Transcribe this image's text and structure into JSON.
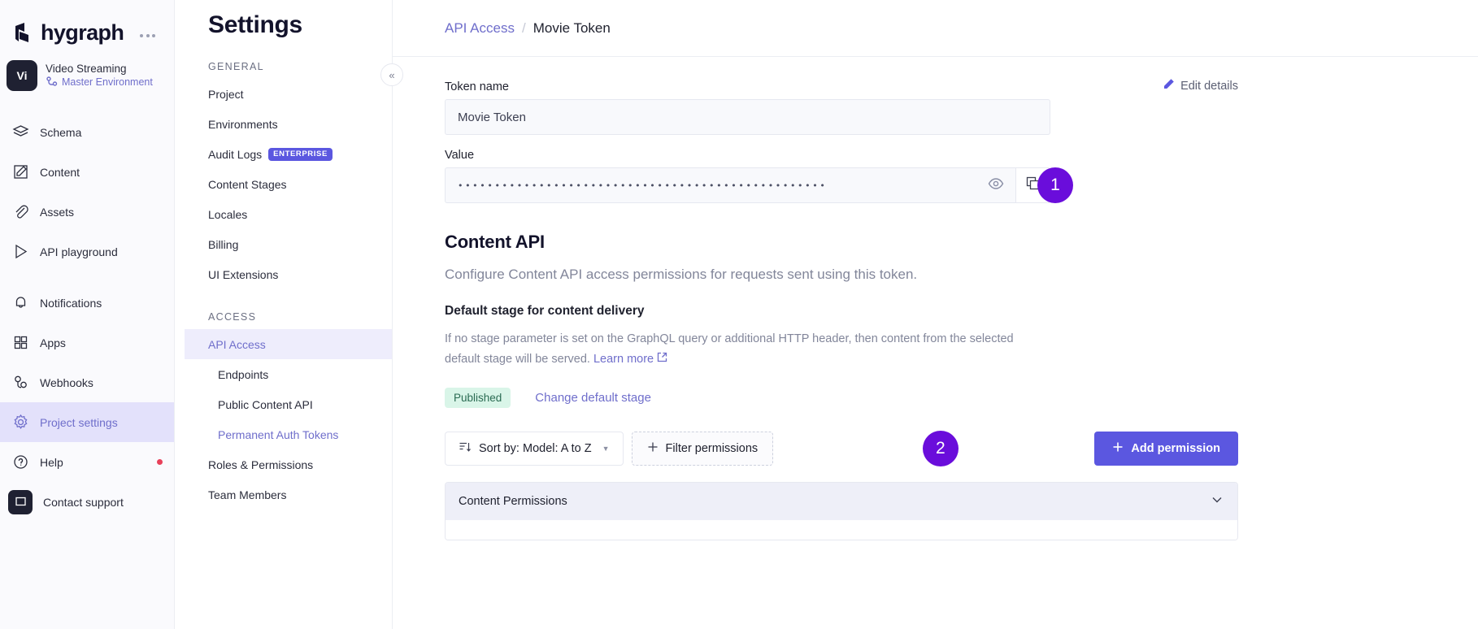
{
  "brand": {
    "name": "hygraph",
    "accent": "#5b57e0",
    "marker_color": "#6a0ddb"
  },
  "rail": {
    "project": {
      "avatar": "Vi",
      "name": "Video Streaming",
      "environment": "Master Environment"
    },
    "items": [
      {
        "label": "Schema",
        "icon": "layers-icon",
        "active": false
      },
      {
        "label": "Content",
        "icon": "edit-square-icon",
        "active": false
      },
      {
        "label": "Assets",
        "icon": "paperclip-icon",
        "active": false
      },
      {
        "label": "API playground",
        "icon": "play-icon",
        "active": false
      },
      {
        "label": "Notifications",
        "icon": "bell-icon",
        "active": false
      },
      {
        "label": "Apps",
        "icon": "grid-icon",
        "active": false
      },
      {
        "label": "Webhooks",
        "icon": "webhook-icon",
        "active": false
      },
      {
        "label": "Project settings",
        "icon": "gear-icon",
        "active": true
      },
      {
        "label": "Help",
        "icon": "question-circle-icon",
        "active": false
      },
      {
        "label": "Contact support",
        "icon": "chat-icon",
        "active": false
      }
    ]
  },
  "settings": {
    "title": "Settings",
    "groups": [
      {
        "label": "GENERAL",
        "items": [
          {
            "label": "Project",
            "badge": "",
            "active": false,
            "sub": false,
            "link": false
          },
          {
            "label": "Environments",
            "badge": "",
            "active": false,
            "sub": false,
            "link": false
          },
          {
            "label": "Audit Logs",
            "badge": "ENTERPRISE",
            "active": false,
            "sub": false,
            "link": false
          },
          {
            "label": "Content Stages",
            "badge": "",
            "active": false,
            "sub": false,
            "link": false
          },
          {
            "label": "Locales",
            "badge": "",
            "active": false,
            "sub": false,
            "link": false
          },
          {
            "label": "Billing",
            "badge": "",
            "active": false,
            "sub": false,
            "link": false
          },
          {
            "label": "UI Extensions",
            "badge": "",
            "active": false,
            "sub": false,
            "link": false
          }
        ]
      },
      {
        "label": "ACCESS",
        "items": [
          {
            "label": "API Access",
            "badge": "",
            "active": true,
            "sub": false,
            "link": false
          },
          {
            "label": "Endpoints",
            "badge": "",
            "active": false,
            "sub": true,
            "link": false
          },
          {
            "label": "Public Content API",
            "badge": "",
            "active": false,
            "sub": true,
            "link": false
          },
          {
            "label": "Permanent Auth Tokens",
            "badge": "",
            "active": false,
            "sub": true,
            "link": true
          },
          {
            "label": "Roles & Permissions",
            "badge": "",
            "active": false,
            "sub": false,
            "link": false
          },
          {
            "label": "Team Members",
            "badge": "",
            "active": false,
            "sub": false,
            "link": false
          }
        ]
      }
    ],
    "collapse_glyph": "«"
  },
  "breadcrumb": {
    "parent": "API Access",
    "separator": "/",
    "current": "Movie Token"
  },
  "token": {
    "name_label": "Token name",
    "name_value": "Movie Token",
    "edit_details_label": "Edit details",
    "value_label": "Value",
    "value_masked": "••••••••••••••••••••••••••••••••••••••••••••••••••",
    "marker_one": "1"
  },
  "content_api": {
    "title": "Content API",
    "description": "Configure Content API access permissions for requests sent using this token.",
    "default_stage_title": "Default stage for content delivery",
    "default_stage_desc": "If no stage parameter is set on the GraphQL query or additional HTTP header, then content from the selected default stage will be served.",
    "learn_more": "Learn more",
    "stage_badge": "Published",
    "change_stage_label": "Change default stage"
  },
  "toolbar": {
    "sort_label": "Sort by: Model: A to Z",
    "filter_label": "Filter permissions",
    "add_label": "Add permission",
    "marker_two": "2"
  },
  "permissions_panel": {
    "title": "Content Permissions"
  }
}
